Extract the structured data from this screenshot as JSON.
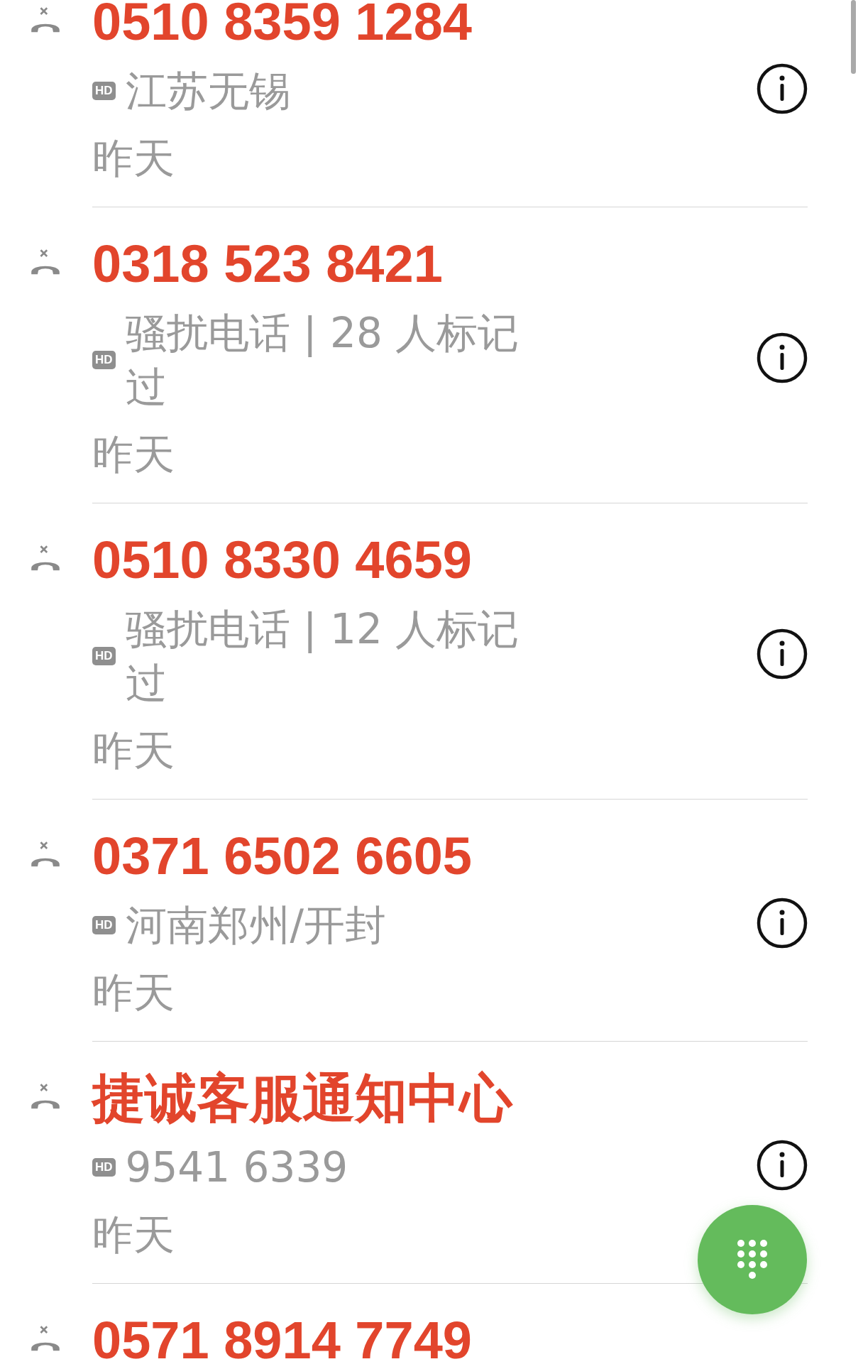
{
  "calls": [
    {
      "name": "0510 8359 1284",
      "badge": "HD",
      "detail": "江苏无锡",
      "date": "昨天"
    },
    {
      "name": "0318 523 8421",
      "badge": "HD",
      "detail": "骚扰电话 | 28 人标记过",
      "date": "昨天"
    },
    {
      "name": "0510 8330 4659",
      "badge": "HD",
      "detail": "骚扰电话 | 12 人标记过",
      "date": "昨天"
    },
    {
      "name": "0371 6502 6605",
      "badge": "HD",
      "detail": "河南郑州/开封",
      "date": "昨天"
    },
    {
      "name": "捷诚客服通知中心",
      "badge": "HD",
      "detail": "9541 6339",
      "date": "昨天"
    },
    {
      "name": "0571 8914 7749"
    }
  ]
}
